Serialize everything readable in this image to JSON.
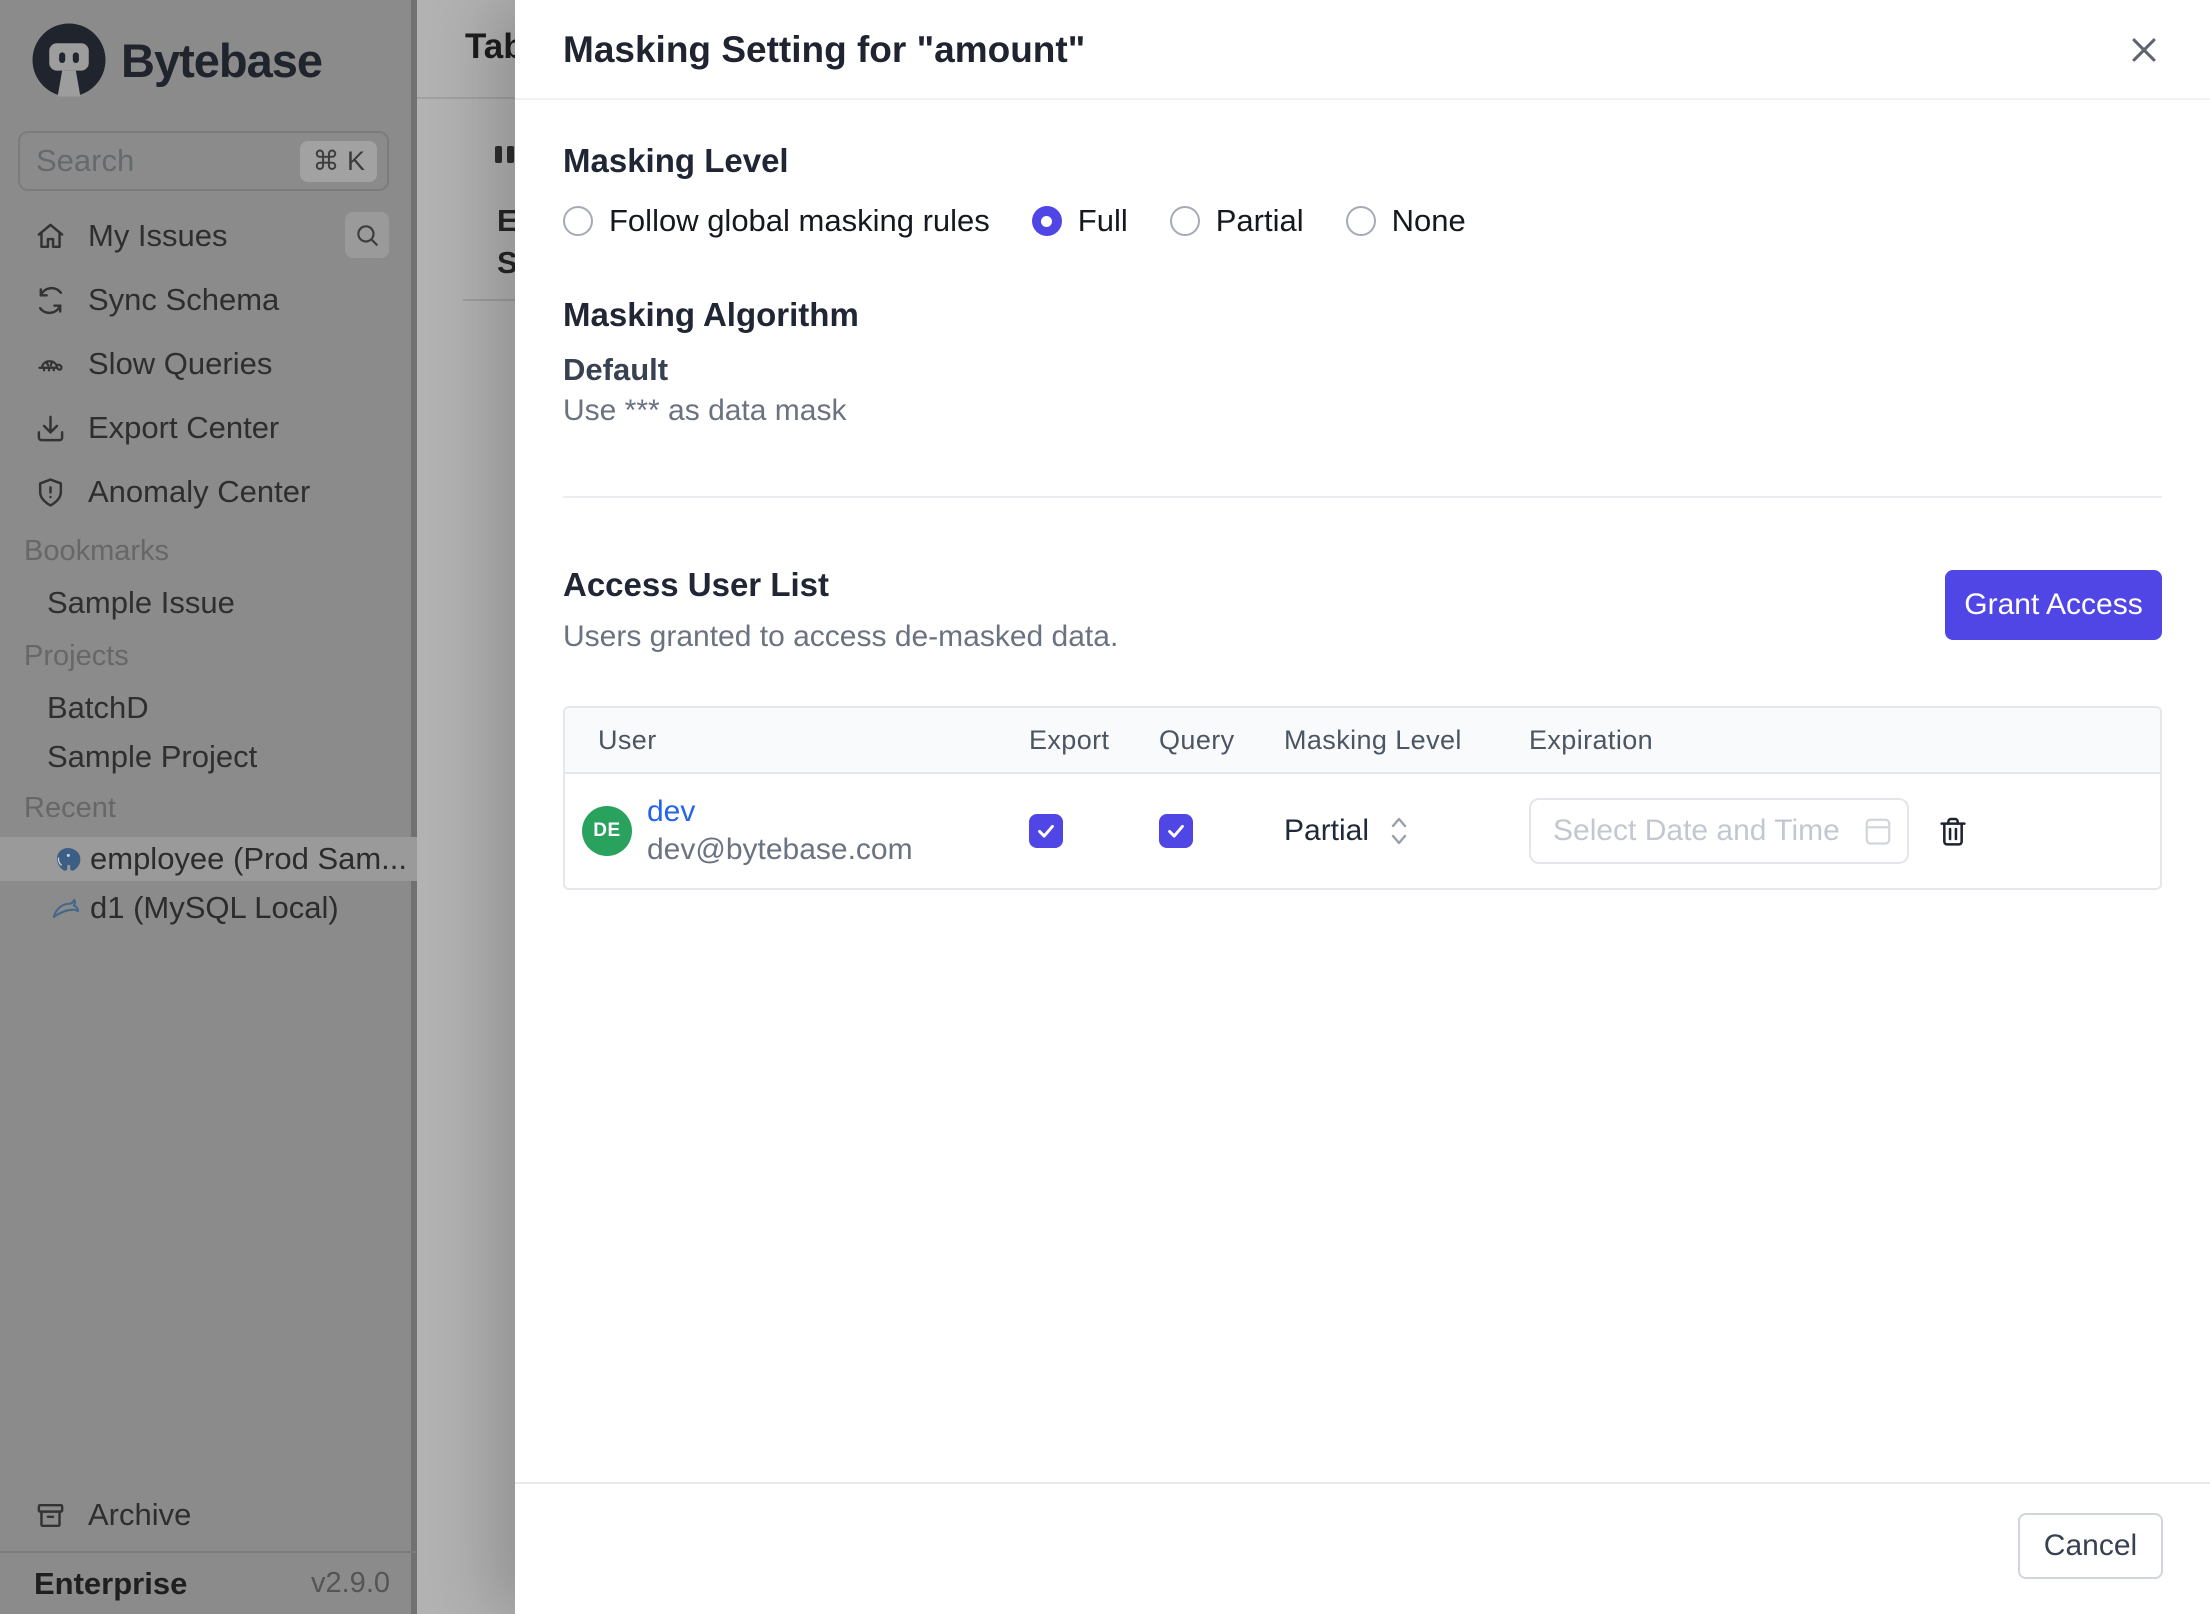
{
  "sidebar": {
    "brand": "Bytebase",
    "search_placeholder": "Search",
    "search_shortcut": "⌘ K",
    "nav": [
      {
        "label": "My Issues",
        "icon": "home-icon"
      },
      {
        "label": "Sync Schema",
        "icon": "sync-icon"
      },
      {
        "label": "Slow Queries",
        "icon": "turtle-icon"
      },
      {
        "label": "Export Center",
        "icon": "download-icon"
      },
      {
        "label": "Anomaly Center",
        "icon": "shield-alert-icon"
      }
    ],
    "sections": [
      {
        "label": "Bookmarks",
        "items": [
          "Sample Issue"
        ]
      },
      {
        "label": "Projects",
        "items": [
          "BatchD",
          "Sample Project"
        ]
      },
      {
        "label": "Recent",
        "items": [
          "employee (Prod Sam...",
          "d1 (MySQL Local)"
        ]
      }
    ],
    "archive_label": "Archive",
    "plan": "Enterprise",
    "version": "v2.9.0"
  },
  "background_page": {
    "clipped_title": "Tab",
    "clipped_label_1": "E",
    "clipped_label_2": "S"
  },
  "drawer": {
    "title": "Masking Setting for \"amount\"",
    "masking_level": {
      "heading": "Masking Level",
      "options": [
        {
          "label": "Follow global masking rules",
          "selected": false
        },
        {
          "label": "Full",
          "selected": true
        },
        {
          "label": "Partial",
          "selected": false
        },
        {
          "label": "None",
          "selected": false
        }
      ]
    },
    "masking_algorithm": {
      "heading": "Masking Algorithm",
      "name": "Default",
      "description": "Use *** as data mask"
    },
    "access": {
      "heading": "Access User List",
      "subtitle": "Users granted to access de-masked data.",
      "grant_button": "Grant Access",
      "columns": [
        "User",
        "Export",
        "Query",
        "Masking Level",
        "Expiration"
      ],
      "rows": [
        {
          "name": "dev",
          "email": "dev@bytebase.com",
          "initials": "DE",
          "export_checked": true,
          "query_checked": true,
          "masking_level": "Partial",
          "expiration_placeholder": "Select Date and Time"
        }
      ]
    },
    "cancel_button": "Cancel"
  },
  "colors": {
    "accent": "#4f46e5",
    "link": "#2563eb",
    "avatar_green": "#28a25d"
  }
}
